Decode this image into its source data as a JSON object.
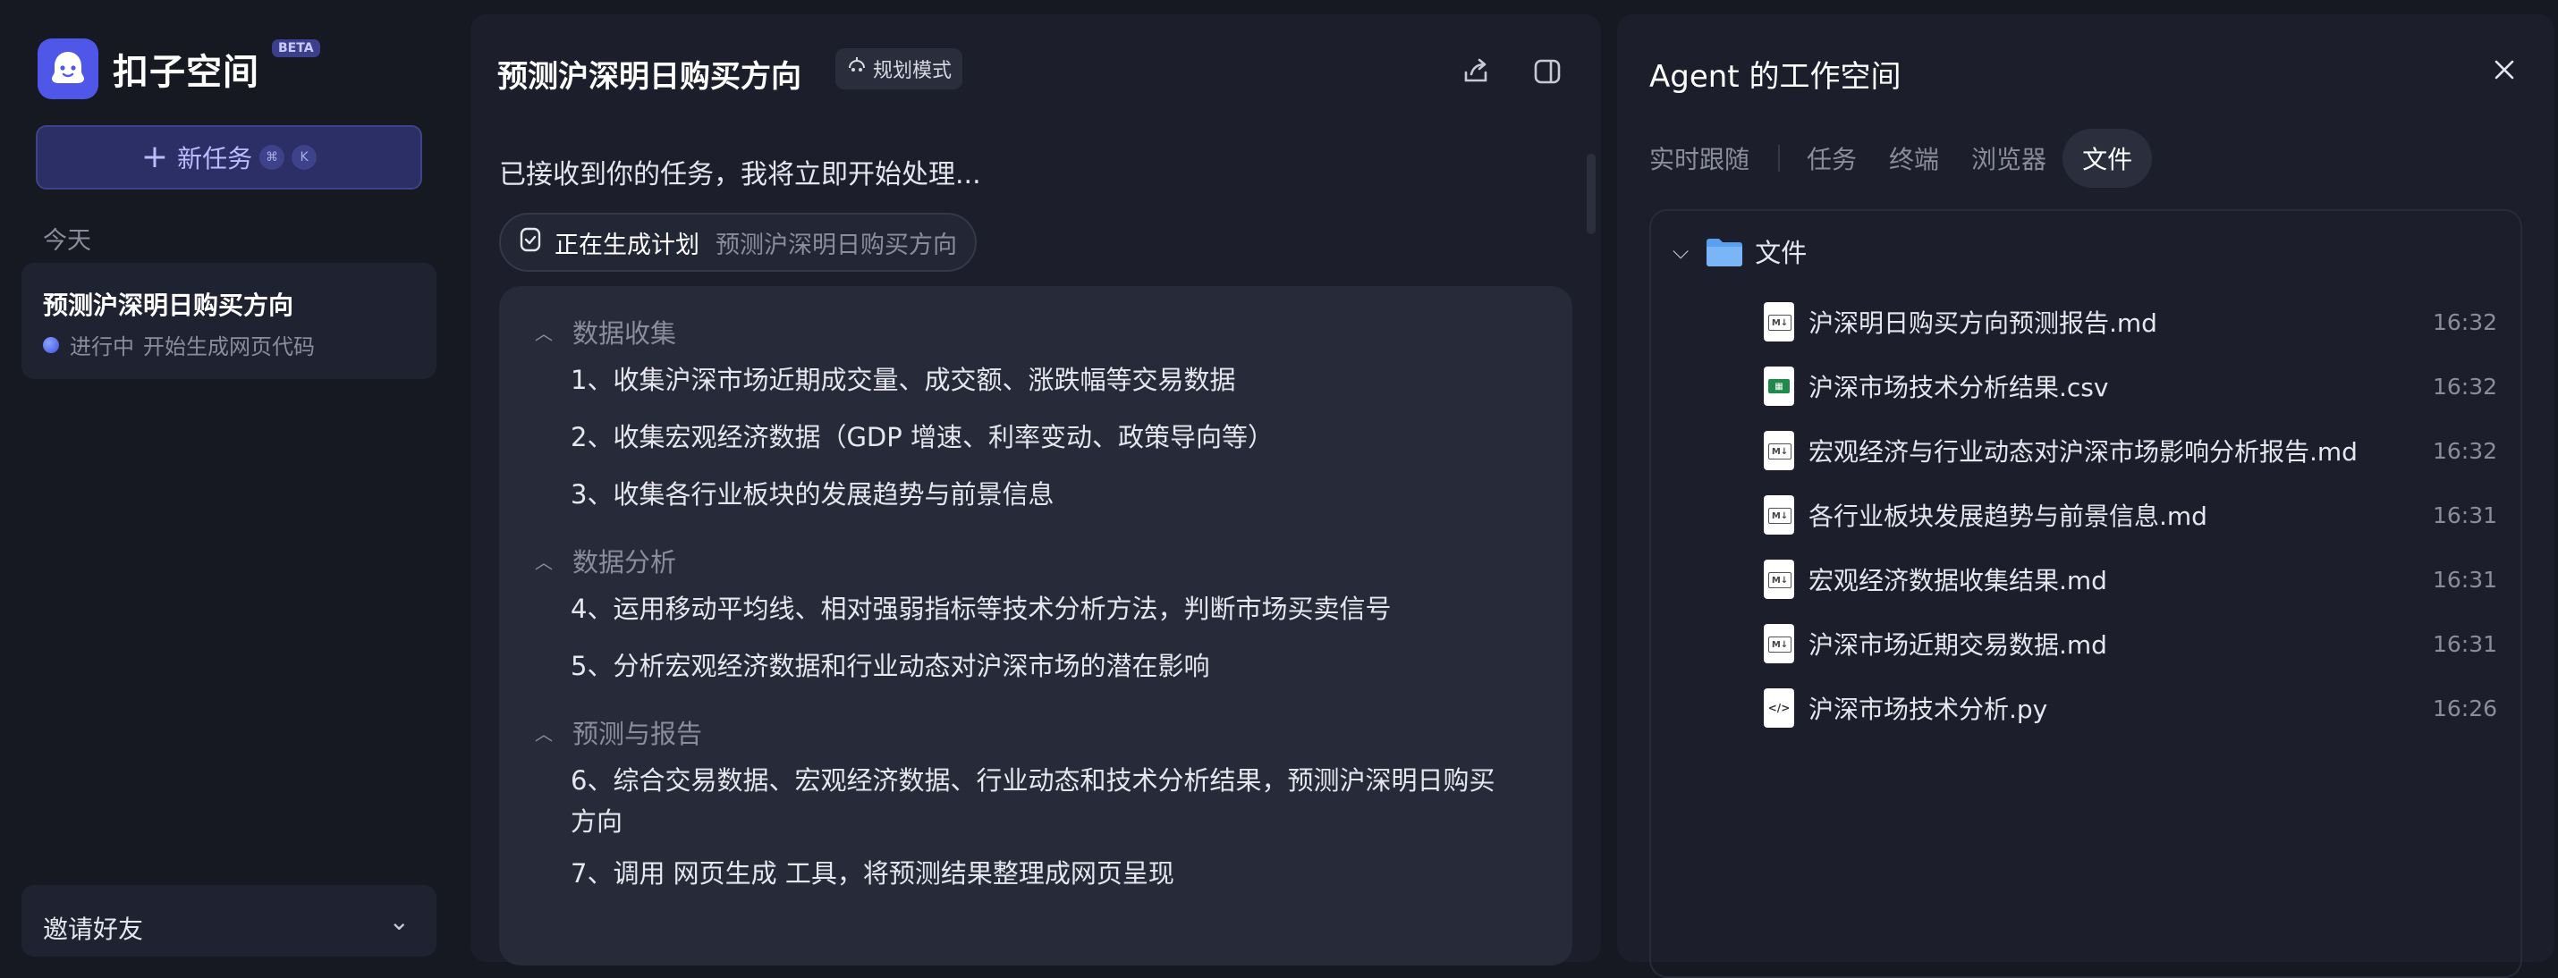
{
  "sidebar": {
    "brand_name": "扣子空间",
    "beta_badge": "BETA",
    "new_task_label": "新任务",
    "shortcut_keys": [
      "⌘",
      "K"
    ],
    "section_today": "今天",
    "history": [
      {
        "title": "预测沪深明日购买方向",
        "status": "进行中",
        "status_detail": "开始生成网页代码"
      }
    ],
    "invite_label": "邀请好友"
  },
  "chat": {
    "title": "预测沪深明日购买方向",
    "mode_badge": "规划模式",
    "intro_text": "已接收到你的任务，我将立即开始处理...",
    "progress_pill": {
      "main": "正在生成计划",
      "sub": "预测沪深明日购买方向"
    },
    "plan": [
      {
        "section": "数据收集",
        "steps": [
          "1、收集沪深市场近期成交量、成交额、涨跌幅等交易数据",
          "2、收集宏观经济数据（GDP 增速、利率变动、政策导向等）",
          "3、收集各行业板块的发展趋势与前景信息"
        ]
      },
      {
        "section": "数据分析",
        "steps": [
          "4、运用移动平均线、相对强弱指标等技术分析方法，判断市场买卖信号",
          "5、分析宏观经济数据和行业动态对沪深市场的潜在影响"
        ]
      },
      {
        "section": "预测与报告",
        "steps": [
          "6、综合交易数据、宏观经济数据、行业动态和技术分析结果，预测沪深明日购买方向",
          "7、调用 网页生成 工具，将预测结果整理成网页呈现"
        ]
      }
    ]
  },
  "workspace": {
    "title": "Agent 的工作空间",
    "tabs": [
      "实时跟随",
      "任务",
      "终端",
      "浏览器",
      "文件"
    ],
    "active_tab": "文件",
    "folder_name": "文件",
    "files": [
      {
        "name": "沪深明日购买方向预测报告.md",
        "time": "16:32",
        "icon": "markdown-file-icon"
      },
      {
        "name": "沪深市场技术分析结果.csv",
        "time": "16:32",
        "icon": "spreadsheet-file-icon"
      },
      {
        "name": "宏观经济与行业动态对沪深市场影响分析报告.md",
        "time": "16:32",
        "icon": "markdown-file-icon"
      },
      {
        "name": "各行业板块发展趋势与前景信息.md",
        "time": "16:31",
        "icon": "markdown-file-icon"
      },
      {
        "name": "宏观经济数据收集结果.md",
        "time": "16:31",
        "icon": "markdown-file-icon"
      },
      {
        "name": "沪深市场近期交易数据.md",
        "time": "16:31",
        "icon": "markdown-file-icon"
      },
      {
        "name": "沪深市场技术分析.py",
        "time": "16:26",
        "icon": "code-file-icon"
      }
    ]
  },
  "colors": {
    "background": "#161822",
    "panel": "#1c1f2b",
    "accent": "#4f57e8",
    "new_task_bg": "#2c2f66",
    "folder": "#5aa0f0",
    "csv_green": "#1f8a4c"
  }
}
